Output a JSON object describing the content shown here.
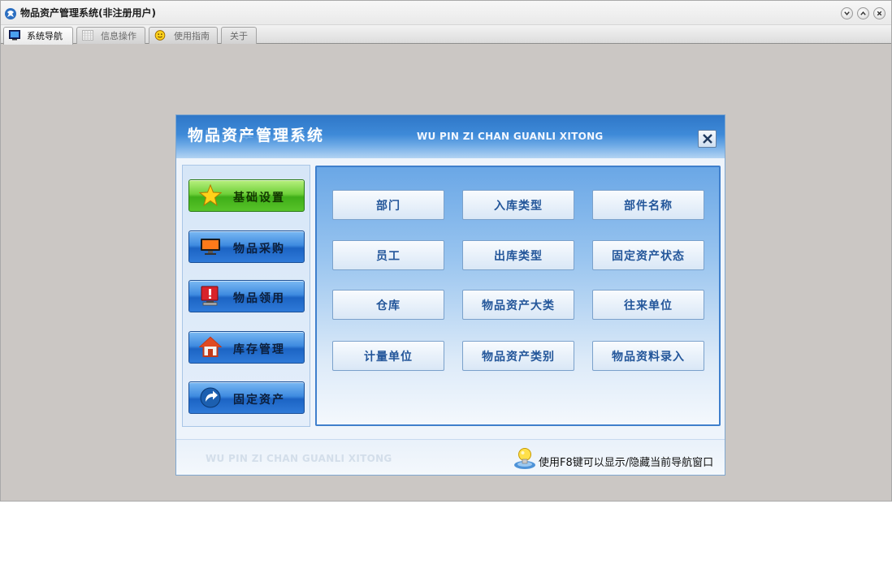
{
  "window": {
    "title": "物品资产管理系统(非注册用户)",
    "controls": [
      "minimize-icon",
      "maximize-icon",
      "close-icon"
    ]
  },
  "tabs": [
    {
      "label": "系统导航",
      "icon": "monitor-icon",
      "active": true
    },
    {
      "label": "信息操作",
      "icon": "grid-icon",
      "active": false
    },
    {
      "label": "使用指南",
      "icon": "smiley-icon",
      "active": false
    },
    {
      "label": "关于",
      "icon": "",
      "active": false
    }
  ],
  "nav": {
    "title": "物品资产管理系统",
    "pinyin": "WU PIN ZI CHAN GUANLI XITONG",
    "sidebar": [
      {
        "label": "基础设置",
        "icon": "star-icon",
        "active": true
      },
      {
        "label": "物品采购",
        "icon": "monitor-icon",
        "active": false
      },
      {
        "label": "物品领用",
        "icon": "alert-monitor-icon",
        "active": false
      },
      {
        "label": "库存管理",
        "icon": "home-icon",
        "active": false
      },
      {
        "label": "固定资产",
        "icon": "arrow-refresh-icon",
        "active": false
      }
    ],
    "functions": [
      [
        "部门",
        "入库类型",
        "部件名称"
      ],
      [
        "员工",
        "出库类型",
        "固定资产状态"
      ],
      [
        "仓库",
        "物品资产大类",
        "往来单位"
      ],
      [
        "计量单位",
        "物品资产类别",
        "物品资料录入"
      ]
    ],
    "footer_pinyin": "WU PIN ZI CHAN GUANLI XITONG",
    "hint": "使用F8键可以显示/隐藏当前导航窗口"
  },
  "colors": {
    "header_blue": "#3e8ad8",
    "active_green": "#6fd03a",
    "button_text": "#23569a"
  }
}
